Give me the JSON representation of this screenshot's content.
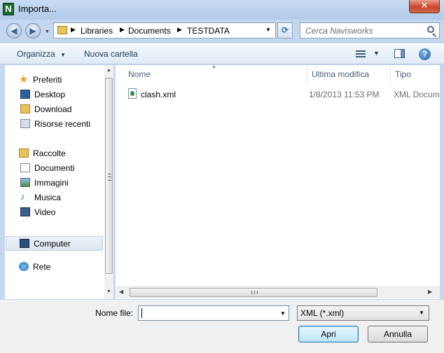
{
  "window": {
    "title": "Importa...",
    "app_icon_letter": "N",
    "close_glyph": "✕"
  },
  "navigation": {
    "back_glyph": "◀",
    "forward_glyph": "▶",
    "history_dropdown_glyph": "▼",
    "breadcrumb_separator": "▶",
    "breadcrumbs": [
      "Libraries",
      "Documents",
      "TESTDATA"
    ],
    "address_dropdown_glyph": "▼",
    "refresh_glyph": "⟳",
    "search_placeholder": "Cerca Navisworks"
  },
  "toolbar": {
    "organize_label": "Organizza",
    "organize_dropdown_glyph": "▼",
    "new_folder_label": "Nuova cartella",
    "views_dropdown_glyph": "▼",
    "help_glyph": "?"
  },
  "sidebar": {
    "groups": [
      {
        "label": "Preferiti",
        "icon": "star-icon",
        "items": [
          {
            "label": "Desktop",
            "icon": "desktop-icon"
          },
          {
            "label": "Download",
            "icon": "downloads-folder-icon"
          },
          {
            "label": "Risorse recenti",
            "icon": "recent-places-icon"
          }
        ]
      },
      {
        "label": "Raccolte",
        "icon": "libraries-icon",
        "items": [
          {
            "label": "Documenti",
            "icon": "documents-icon"
          },
          {
            "label": "Immagini",
            "icon": "pictures-icon"
          },
          {
            "label": "Musica",
            "icon": "music-icon"
          },
          {
            "label": "Video",
            "icon": "video-icon"
          }
        ]
      },
      {
        "label": "Computer",
        "icon": "computer-icon",
        "selected": true,
        "items": []
      },
      {
        "label": "Rete",
        "icon": "network-icon",
        "items": []
      }
    ],
    "scroll_up_glyph": "▲",
    "scroll_down_glyph": "▼"
  },
  "file_list": {
    "columns": [
      "Nome",
      "Ultima modifica",
      "Tipo"
    ],
    "sort_column": "Nome",
    "sort_glyph": "▲",
    "rows": [
      {
        "name": "clash.xml",
        "modified": "1/8/2013 11:53 PM",
        "type": "XML Docum",
        "icon": "xml-file-icon"
      }
    ],
    "scroll_left_glyph": "◀",
    "scroll_right_glyph": "▶"
  },
  "footer": {
    "filename_label": "Nome file:",
    "filename_value": "",
    "filename_dropdown_glyph": "▼",
    "filetype_value": "XML (*.xml)",
    "filetype_dropdown_glyph": "▼",
    "open_label": "Apri",
    "cancel_label": "Annulla"
  },
  "colors": {
    "frame": "#c4d7ee",
    "toolbar_text": "#1e395b",
    "close_button": "#c7452b",
    "header_text": "#4c607a"
  }
}
